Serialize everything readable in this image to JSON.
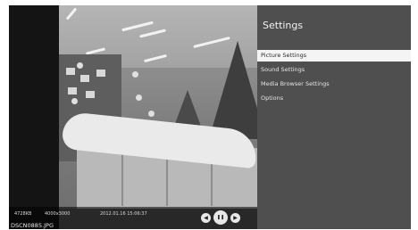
{
  "settings": {
    "title": "Settings",
    "menu": [
      {
        "label": "Picture Settings",
        "selected": true
      },
      {
        "label": "Sound Settings",
        "selected": false
      },
      {
        "label": "Media Browser Settings",
        "selected": false
      },
      {
        "label": "Options",
        "selected": false
      }
    ]
  },
  "photo_info": {
    "file_size": "4728KB",
    "resolution": "4000x3000",
    "date_time": "2012.01.16 15:06:37",
    "file_name": "DSCN0885.JPG"
  },
  "controls": {
    "prev_icon": "previous-icon",
    "pause_icon": "pause-icon",
    "next_icon": "next-icon",
    "prev_glyph": "◀",
    "pause_glyph": "❚❚",
    "next_glyph": "▶"
  },
  "colors": {
    "panel_bg": "#4f4f4f",
    "selected_bg": "#f4f4f4"
  }
}
